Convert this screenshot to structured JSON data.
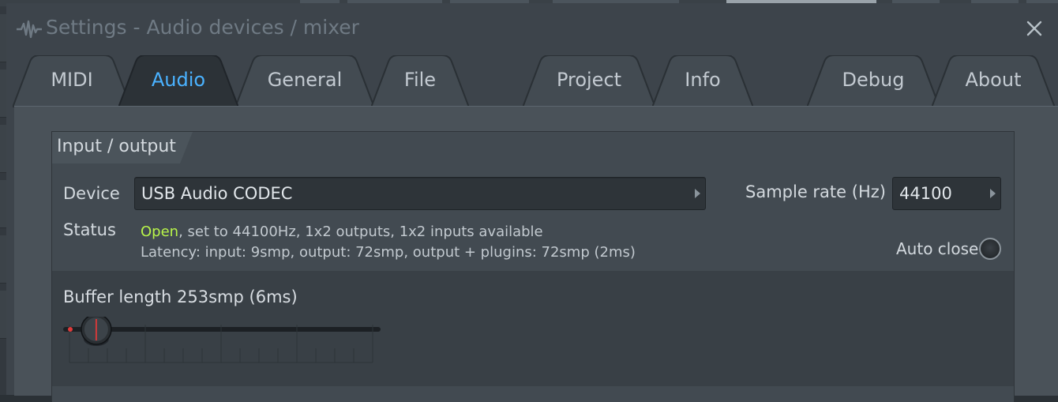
{
  "window": {
    "title": "Settings - Audio devices / mixer",
    "close_icon": "close-icon",
    "logo_icon": "fl-waveform-logo-icon"
  },
  "tabs": [
    {
      "label": "MIDI",
      "active": false
    },
    {
      "label": "Audio",
      "active": true
    },
    {
      "label": "General",
      "active": false
    },
    {
      "label": "File",
      "active": false
    },
    {
      "label": "Project",
      "active": false
    },
    {
      "label": "Info",
      "active": false
    },
    {
      "label": "Debug",
      "active": false
    },
    {
      "label": "About",
      "active": false
    }
  ],
  "io": {
    "section_title": "Input / output",
    "device_label": "Device",
    "device_value": "USB Audio CODEC",
    "sample_rate_label": "Sample rate (Hz)",
    "sample_rate_value": "44100",
    "status_label": "Status",
    "status_open": "Open",
    "status_rest": ", set to 44100Hz, 1x2 outputs, 1x2 inputs available",
    "latency_text": "Latency: input: 9smp, output: 72smp, output + plugins: 72smp (2ms)",
    "auto_close_label": "Auto close",
    "auto_close_on": false
  },
  "buffer": {
    "label": "Buffer length 253smp (6ms)",
    "slider_fraction": 0.07
  },
  "colors": {
    "active_tab": "#4ab2ff",
    "status_open": "#b8f44a",
    "slider_marker": "#e03a3a"
  }
}
